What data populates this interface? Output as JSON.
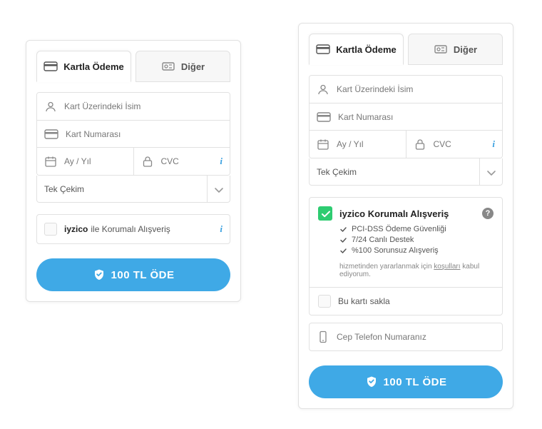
{
  "tabs": {
    "card": "Kartla Ödeme",
    "other": "Diğer"
  },
  "fields": {
    "name_placeholder": "Kart Üzerindeki İsim",
    "number_placeholder": "Kart Numarası",
    "expiry_placeholder": "Ay / Yıl",
    "cvc_placeholder": "CVC"
  },
  "installment_selected": "Tek Çekim",
  "left": {
    "protect_brand": "iyzico",
    "protect_text": "ile Korumalı Alışveriş"
  },
  "right": {
    "protect_title": "iyzico Korumalı Alışveriş",
    "bullets": [
      "PCI-DSS Ödeme Güvenliği",
      "7/24 Canlı Destek",
      "%100 Sorunsuz Alışveriş"
    ],
    "terms_prefix": "hizmetinden yararlanmak için ",
    "terms_link": "koşulları",
    "terms_suffix": " kabul ediyorum.",
    "save_card": "Bu kartı sakla",
    "phone_placeholder": "Cep Telefon Numaranız"
  },
  "pay_label": "100 TL ÖDE"
}
